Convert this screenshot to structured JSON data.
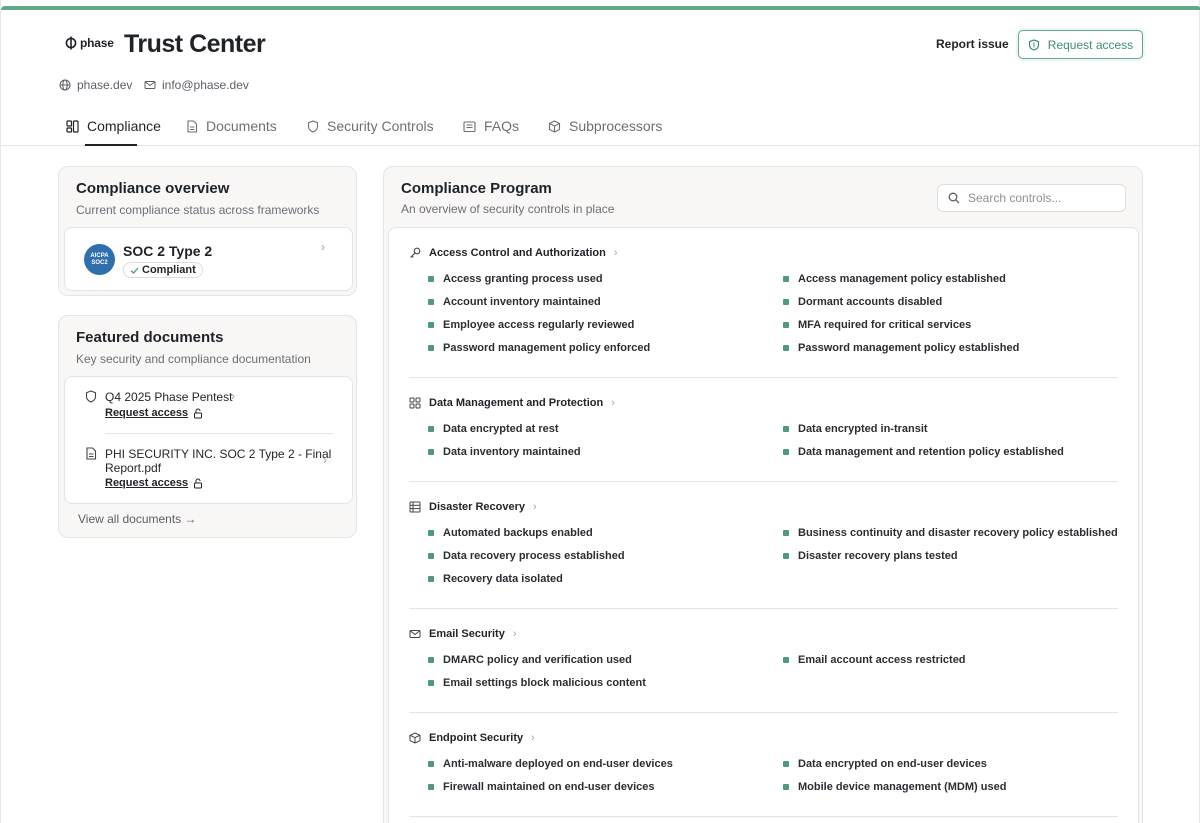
{
  "header": {
    "brand": "phase",
    "title": "Trust Center",
    "report_issue": "Report issue",
    "request_access": "Request access",
    "website": "phase.dev",
    "email": "info@phase.dev"
  },
  "tabs": [
    {
      "label": "Compliance",
      "active": true
    },
    {
      "label": "Documents"
    },
    {
      "label": "Security Controls"
    },
    {
      "label": "FAQs"
    },
    {
      "label": "Subprocessors"
    }
  ],
  "overview": {
    "title": "Compliance overview",
    "subtitle": "Current compliance status across frameworks",
    "framework": {
      "name": "SOC 2 Type 2",
      "status": "Compliant",
      "badge_line1": "AICPA",
      "badge_line2": "SOC2"
    }
  },
  "featured": {
    "title": "Featured documents",
    "subtitle": "Key security and compliance documentation",
    "docs": [
      {
        "name": "Q4 2025 Phase Pentest",
        "action": "Request access"
      },
      {
        "name_line1": "PHI SECURITY INC. SOC 2 Type 2 - Final",
        "name_line2": "Report.pdf",
        "action": "Request access"
      }
    ],
    "view_all": "View all documents →"
  },
  "program": {
    "title": "Compliance Program",
    "subtitle": "An overview of security controls in place",
    "search_placeholder": "Search controls...",
    "sections": [
      {
        "title": "Access Control and Authorization",
        "icon": "key-icon",
        "left": [
          "Access granting process used",
          "Account inventory maintained",
          "Employee access regularly reviewed",
          "Password management policy enforced"
        ],
        "right": [
          "Access management policy established",
          "Dormant accounts disabled",
          "MFA required for critical services",
          "Password management policy established"
        ]
      },
      {
        "title": "Data Management and Protection",
        "icon": "grid-icon",
        "left": [
          "Data encrypted at rest",
          "Data inventory maintained"
        ],
        "right": [
          "Data encrypted in-transit",
          "Data management and retention policy established"
        ]
      },
      {
        "title": "Disaster Recovery",
        "icon": "server-icon",
        "left": [
          "Automated backups enabled",
          "Data recovery process established",
          "Recovery data isolated"
        ],
        "right": [
          "Business continuity and disaster recovery policy established",
          "Disaster recovery plans tested"
        ]
      },
      {
        "title": "Email Security",
        "icon": "mail-icon",
        "left": [
          "DMARC policy and verification used",
          "Email settings block malicious content"
        ],
        "right": [
          "Email account access restricted"
        ]
      },
      {
        "title": "Endpoint Security",
        "icon": "cube-icon",
        "left": [
          "Anti-malware deployed on end-user devices",
          "Firewall maintained on end-user devices"
        ],
        "right": [
          "Data encrypted on end-user devices",
          "Mobile device management (MDM) used"
        ]
      }
    ]
  },
  "colors": {
    "accent": "#5ea98a",
    "bullet": "#4f9a7a"
  }
}
